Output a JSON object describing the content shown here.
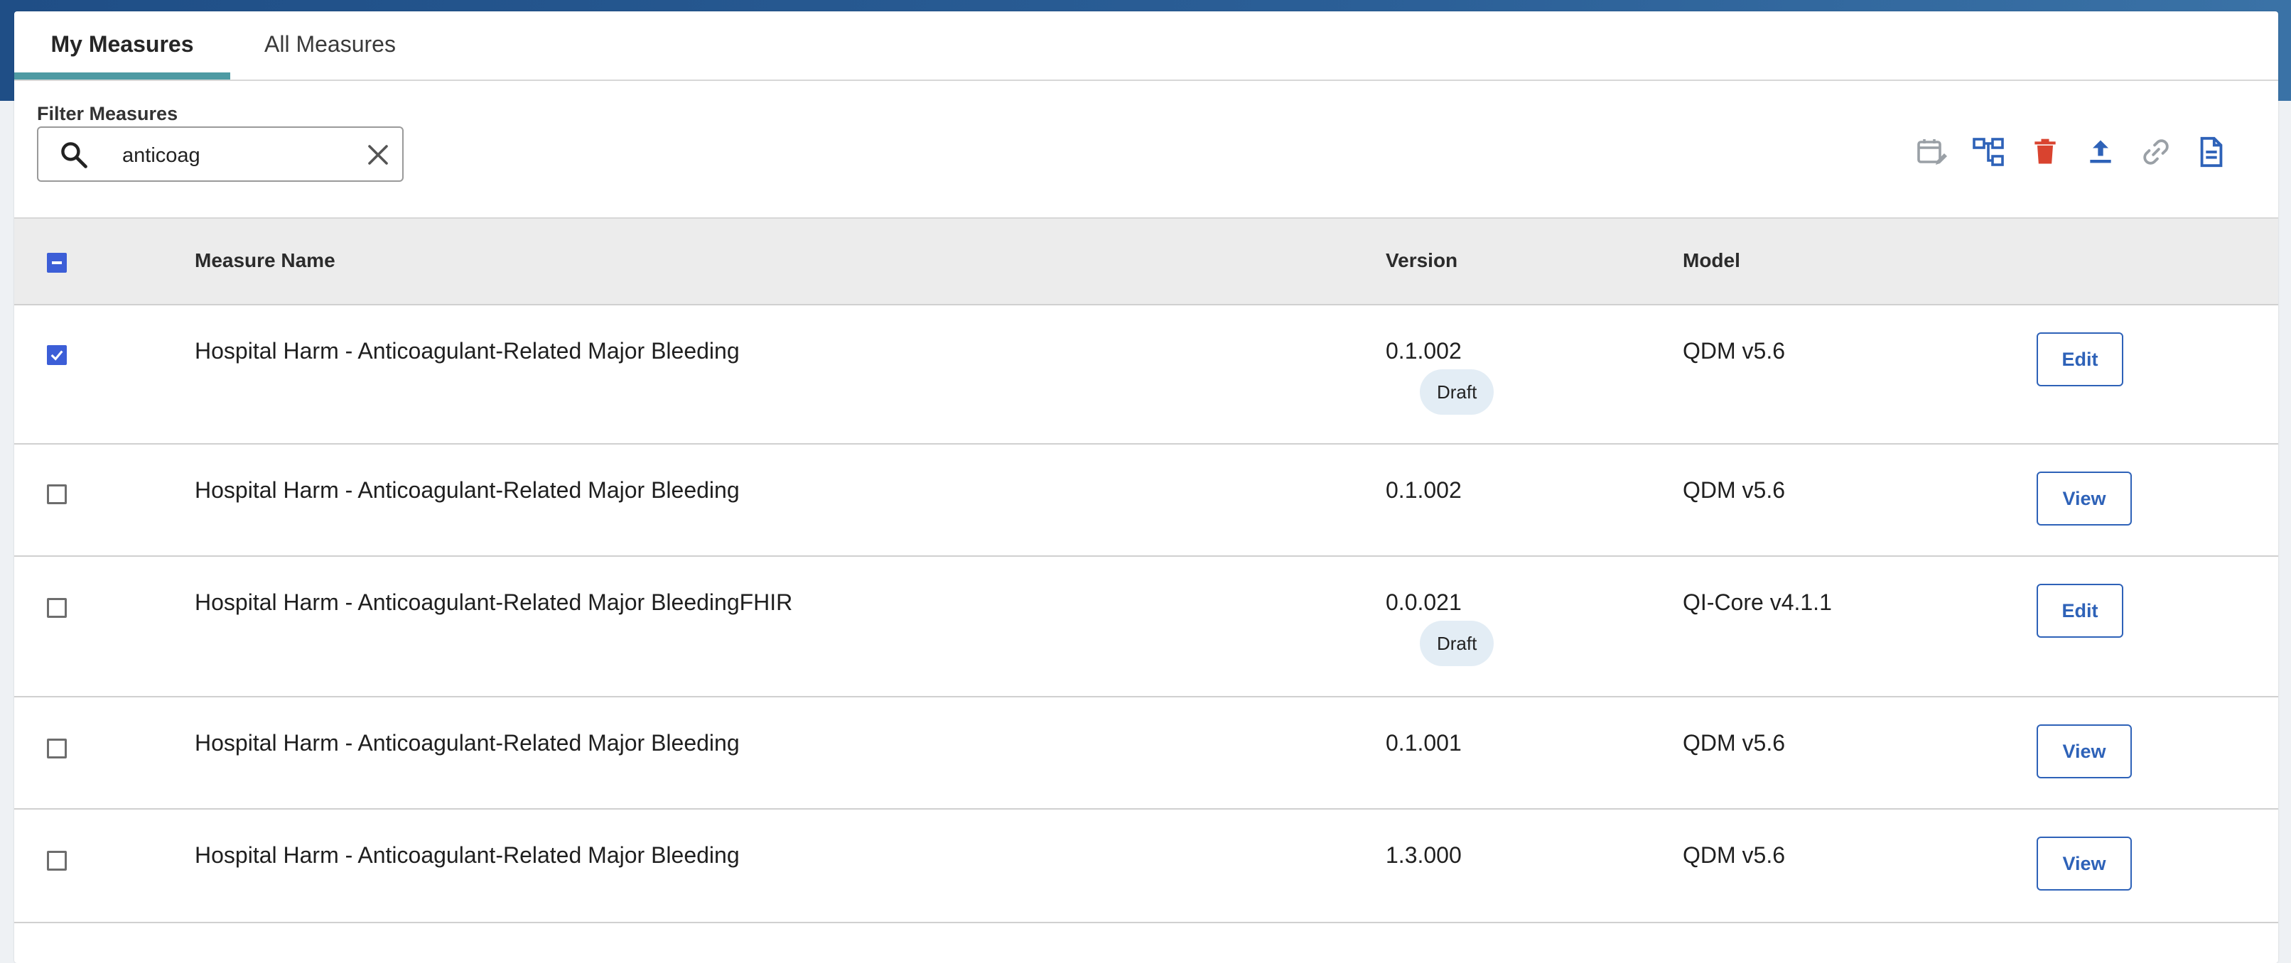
{
  "tabs": [
    {
      "label": "My Measures",
      "active": true
    },
    {
      "label": "All Measures",
      "active": false
    }
  ],
  "filter": {
    "label": "Filter Measures",
    "value": "anticoag"
  },
  "toolbar_icons": [
    "calendar-edit-icon",
    "hierarchy-icon",
    "delete-icon",
    "export-upload-icon",
    "link-icon",
    "document-icon"
  ],
  "colors": {
    "accent": "#4e9aa3",
    "primary": "#2e62b8",
    "checkbox": "#3c5ed7",
    "danger": "#d9432f",
    "muted": "#9aa0a6",
    "badge_bg": "#e3edf5",
    "header_bg": "#ececec"
  },
  "table": {
    "columns": [
      "Measure Name",
      "Version",
      "Model"
    ],
    "select_all_state": "indeterminate",
    "rows": [
      {
        "name": "Hospital Harm - Anticoagulant-Related Major Bleeding",
        "version": "0.1.002",
        "badge": "Draft",
        "model": "QDM v5.6",
        "action": "Edit",
        "selected": true
      },
      {
        "name": "Hospital Harm - Anticoagulant-Related Major Bleeding",
        "version": "0.1.002",
        "badge": "",
        "model": "QDM v5.6",
        "action": "View",
        "selected": false
      },
      {
        "name": "Hospital Harm - Anticoagulant-Related Major BleedingFHIR",
        "version": "0.0.021",
        "badge": "Draft",
        "model": "QI-Core v4.1.1",
        "action": "Edit",
        "selected": false
      },
      {
        "name": "Hospital Harm - Anticoagulant-Related Major Bleeding",
        "version": "0.1.001",
        "badge": "",
        "model": "QDM v5.6",
        "action": "View",
        "selected": false
      },
      {
        "name": "Hospital Harm - Anticoagulant-Related Major Bleeding",
        "version": "1.3.000",
        "badge": "",
        "model": "QDM v5.6",
        "action": "View",
        "selected": false
      }
    ]
  }
}
